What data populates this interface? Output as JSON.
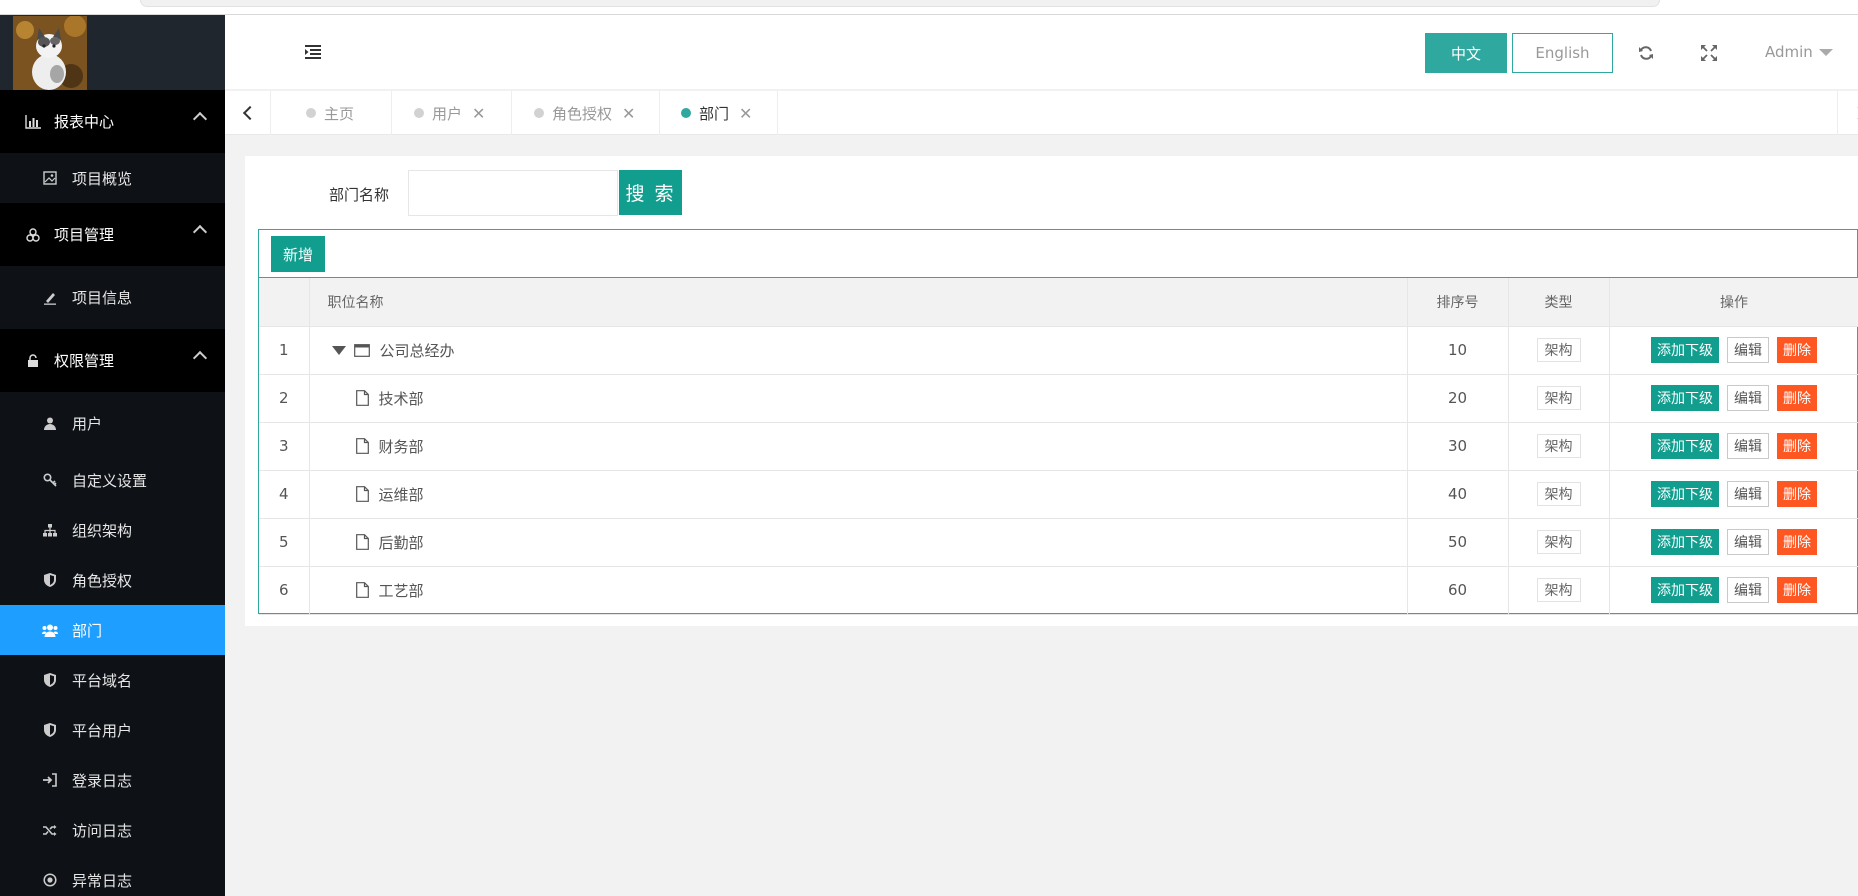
{
  "colors": {
    "sidebar_bg": "#0e1217",
    "active_menu": "#1e9fff",
    "accent": "#129e8e",
    "danger": "#ff5722"
  },
  "sidebar": {
    "groups": [
      {
        "label": "报表中心",
        "icon": "bar-chart-icon",
        "items": [
          {
            "label": "项目概览",
            "icon": "image-icon"
          }
        ]
      },
      {
        "label": "项目管理",
        "icon": "cube-icon",
        "items": [
          {
            "label": "项目信息",
            "icon": "pencil-icon"
          }
        ]
      },
      {
        "label": "权限管理",
        "icon": "unlock-icon",
        "items": [
          {
            "label": "用户",
            "icon": "user-icon"
          },
          {
            "label": "自定义设置",
            "icon": "key-icon"
          },
          {
            "label": "组织架构",
            "icon": "sitemap-icon"
          },
          {
            "label": "角色授权",
            "icon": "shield-icon"
          },
          {
            "label": "部门",
            "icon": "users-icon",
            "active": true
          },
          {
            "label": "平台域名",
            "icon": "shield-icon"
          },
          {
            "label": "平台用户",
            "icon": "shield-icon"
          },
          {
            "label": "登录日志",
            "icon": "sign-in-icon"
          },
          {
            "label": "访问日志",
            "icon": "random-icon"
          },
          {
            "label": "异常日志",
            "icon": "circle-dot-icon"
          }
        ]
      }
    ]
  },
  "header": {
    "lang_cn": "中文",
    "lang_en": "English",
    "user": "Admin"
  },
  "tabs": [
    {
      "label": "主页",
      "closable": false,
      "active": false
    },
    {
      "label": "用户",
      "closable": true,
      "active": false
    },
    {
      "label": "角色授权",
      "closable": true,
      "active": false
    },
    {
      "label": "部门",
      "closable": true,
      "active": true
    }
  ],
  "search": {
    "label": "部门名称",
    "value": "",
    "button": "搜 索"
  },
  "toolbar": {
    "add_label": "新增"
  },
  "table": {
    "headers": {
      "name": "职位名称",
      "sort": "排序号",
      "type": "类型",
      "ops": "操作"
    },
    "ops": {
      "add_child": "添加下级",
      "edit": "编辑",
      "delete": "删除"
    },
    "rows": [
      {
        "index": "1",
        "name": "公司总经办",
        "sort": "10",
        "type": "架构",
        "level": 0
      },
      {
        "index": "2",
        "name": "技术部",
        "sort": "20",
        "type": "架构",
        "level": 1
      },
      {
        "index": "3",
        "name": "财务部",
        "sort": "30",
        "type": "架构",
        "level": 1
      },
      {
        "index": "4",
        "name": "运维部",
        "sort": "40",
        "type": "架构",
        "level": 1
      },
      {
        "index": "5",
        "name": "后勤部",
        "sort": "50",
        "type": "架构",
        "level": 1
      },
      {
        "index": "6",
        "name": "工艺部",
        "sort": "60",
        "type": "架构",
        "level": 1
      }
    ]
  }
}
